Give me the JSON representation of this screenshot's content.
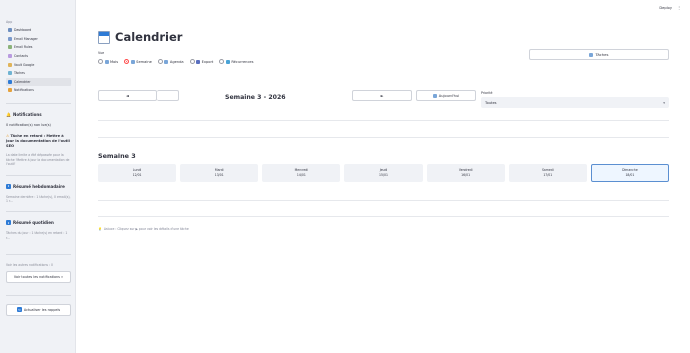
{
  "header": {
    "deploy": "Deploy",
    "menu_glyph": "⋮"
  },
  "sidebar": {
    "app_label": "App",
    "nav": [
      {
        "label": "Dashboard",
        "color": "#6c8ebf"
      },
      {
        "label": "Email Manager",
        "color": "#7b9acc"
      },
      {
        "label": "Email Rules",
        "color": "#8bb37a"
      },
      {
        "label": "Contacts",
        "color": "#b99be0"
      },
      {
        "label": "Vault Google",
        "color": "#e0b45a"
      },
      {
        "label": "Tâches",
        "color": "#6fb3d2"
      },
      {
        "label": "Calendrier",
        "color": "#2e7bd6",
        "active": true
      },
      {
        "label": "Notifications",
        "color": "#e6a23c"
      }
    ],
    "notifications": {
      "heading": "Notifications",
      "count_text": "0 notification(s) non lue(s)",
      "alert_title": "Tâche en retard : Mettre à jour la documentation de l'outil SEO",
      "alert_body": "La date limite a été dépassée pour la tâche 'Mettre à jour la documentation de l'outil'"
    },
    "weekly": {
      "heading": "Résumé hebdomadaire",
      "body": "Semaine dernière : 1 tâche(s), 0 email(s), 1 r..."
    },
    "daily": {
      "heading": "Résumé quotidien",
      "body": "Tâches du jour : 1 tâche(s) en retard : 1 r..."
    },
    "other_label": "Voir les autres notifications : 0",
    "view_all_button": "Voir toutes les notifications »",
    "refresh_button": "Actualiser les rappels"
  },
  "main": {
    "title": "Calendrier",
    "view_label": "Vue",
    "view_options": [
      {
        "label": "Mois",
        "selected": false
      },
      {
        "label": "Semaine",
        "selected": true
      },
      {
        "label": "Agenda",
        "selected": false
      },
      {
        "label": "Export",
        "selected": false
      },
      {
        "label": "Récurrences",
        "selected": false
      }
    ],
    "tasks_button": "Tâches",
    "prev_button": "◄",
    "next_button": "►",
    "today_button": "Aujourd'hui",
    "week_title": "Semaine 3 - 2026",
    "priority_label": "Priorité",
    "priority_value": "Toutes",
    "week_heading": "Semaine 3",
    "days": [
      {
        "name": "Lundi",
        "date": "12/01"
      },
      {
        "name": "Mardi",
        "date": "13/01"
      },
      {
        "name": "Mercredi",
        "date": "14/01"
      },
      {
        "name": "Jeudi",
        "date": "15/01"
      },
      {
        "name": "Vendredi",
        "date": "16/01"
      },
      {
        "name": "Samedi",
        "date": "17/01"
      },
      {
        "name": "Dimanche",
        "date": "18/01",
        "today": true
      }
    ],
    "legend": "Astuce : Cliquez sur ▶ pour voir les détails d'une tâche"
  },
  "colors": {
    "accent": "#ff4b4b",
    "blue": "#2e7bd6",
    "sidebar_bg": "#f0f2f6"
  }
}
